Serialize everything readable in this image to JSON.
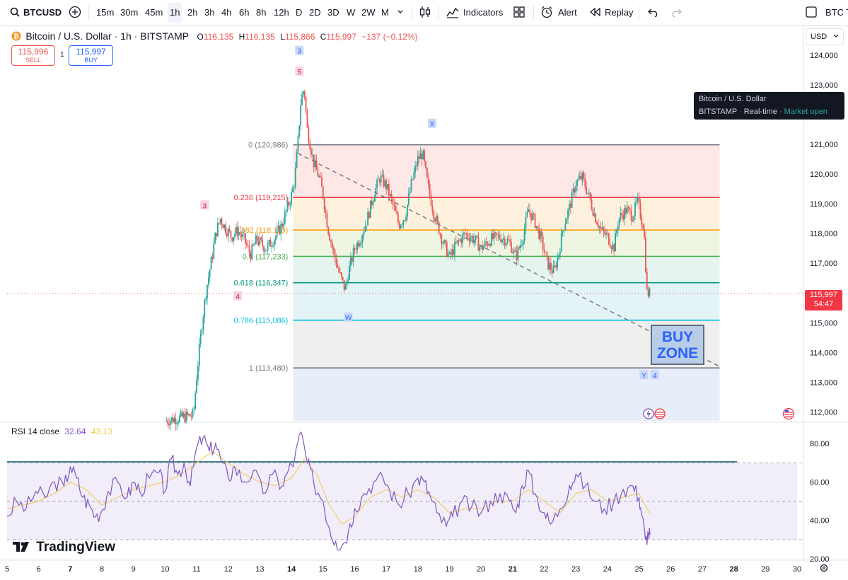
{
  "toolbar": {
    "symbol": "BTCUSD",
    "timeframes": [
      "15m",
      "30m",
      "45m",
      "1h",
      "2h",
      "3h",
      "4h",
      "6h",
      "8h",
      "12h",
      "D",
      "2D",
      "3D",
      "W",
      "2W",
      "M"
    ],
    "active_timeframe": "1h",
    "indicators_label": "Indicators",
    "alert_label": "Alert",
    "replay_label": "Replay",
    "right_label": "BTC T"
  },
  "legend": {
    "title": "Bitcoin / U.S. Dollar · 1h · BITSTAMP",
    "o_label": "O",
    "o_value": "116,135",
    "h_label": "H",
    "h_value": "116,135",
    "l_label": "L",
    "l_value": "115,866",
    "c_label": "C",
    "c_value": "115,997",
    "change": "−137 (−0.12%)",
    "sell_price": "115,996",
    "sell_label": "SELL",
    "spread": "1",
    "buy_price": "115,997",
    "buy_label": "BUY"
  },
  "currency": "USD",
  "tooltip": {
    "title": "Bitcoin / U.S. Dollar",
    "exchange": "BITSTAMP",
    "realtime": "Real-time",
    "status": "Market open"
  },
  "price_badge": {
    "price": "115,997",
    "countdown": "54:47"
  },
  "rsi": {
    "label": "RSI 14 close",
    "value": "32.64",
    "ma_value": "43.13"
  },
  "buy_zone": {
    "line1": "BUY",
    "line2": "ZONE"
  },
  "brand": "TradingView",
  "colors": {
    "up": "#26a69a",
    "down": "#ef5350",
    "rsi": "#7e57c2",
    "rsi_ma": "#f2c94c",
    "accent": "#2962ff"
  },
  "chart_data": {
    "type": "candlestick",
    "symbol": "BTCUSD",
    "interval": "1h",
    "ylim": [
      111700,
      125000
    ],
    "y_ticks": [
      112000,
      113000,
      114000,
      115000,
      116000,
      117000,
      118000,
      119000,
      120000,
      121000,
      122000,
      123000,
      124000
    ],
    "y_tick_labels": [
      "112,000",
      "113,000",
      "114,000",
      "115,000",
      "116,000",
      "117,000",
      "118,000",
      "119,000",
      "120,000",
      "121,000",
      "122,000",
      "123,000",
      "124,000"
    ],
    "x_ticks": [
      "5",
      "6",
      "7",
      "8",
      "9",
      "10",
      "11",
      "12",
      "13",
      "14",
      "15",
      "16",
      "17",
      "18",
      "19",
      "20",
      "21",
      "22",
      "23",
      "24",
      "25",
      "26",
      "27",
      "28",
      "29",
      "30"
    ],
    "x_tick_bold": [
      "7",
      "14",
      "21",
      "28"
    ],
    "x_range_days": [
      5,
      30
    ],
    "close_path": [
      [
        10.0,
        111700
      ],
      [
        10.9,
        111900
      ],
      [
        11.0,
        113200
      ],
      [
        11.15,
        114800
      ],
      [
        11.3,
        116100
      ],
      [
        11.5,
        117300
      ],
      [
        11.6,
        118000
      ],
      [
        11.75,
        118500
      ],
      [
        11.9,
        118200
      ],
      [
        12.1,
        117900
      ],
      [
        12.3,
        118100
      ],
      [
        12.5,
        117800
      ],
      [
        12.7,
        117300
      ],
      [
        12.9,
        117800
      ],
      [
        13.2,
        117500
      ],
      [
        13.5,
        117900
      ],
      [
        13.7,
        118300
      ],
      [
        13.85,
        118800
      ],
      [
        14.0,
        119300
      ],
      [
        14.1,
        119800
      ],
      [
        14.2,
        121000
      ],
      [
        14.3,
        122500
      ],
      [
        14.4,
        122900
      ],
      [
        14.5,
        121500
      ],
      [
        14.7,
        120400
      ],
      [
        14.9,
        119800
      ],
      [
        15.0,
        119300
      ],
      [
        15.15,
        118200
      ],
      [
        15.3,
        117500
      ],
      [
        15.5,
        116700
      ],
      [
        15.7,
        116100
      ],
      [
        15.8,
        116700
      ],
      [
        16.0,
        117500
      ],
      [
        16.2,
        117900
      ],
      [
        16.4,
        118500
      ],
      [
        16.6,
        119300
      ],
      [
        16.8,
        119900
      ],
      [
        17.0,
        119600
      ],
      [
        17.2,
        119000
      ],
      [
        17.4,
        118300
      ],
      [
        17.6,
        118600
      ],
      [
        17.8,
        119700
      ],
      [
        18.0,
        120500
      ],
      [
        18.15,
        120700
      ],
      [
        18.3,
        119700
      ],
      [
        18.5,
        118700
      ],
      [
        18.8,
        117700
      ],
      [
        19.0,
        117200
      ],
      [
        19.2,
        117600
      ],
      [
        19.5,
        118000
      ],
      [
        19.8,
        117800
      ],
      [
        20.0,
        117500
      ],
      [
        20.3,
        117800
      ],
      [
        20.6,
        117900
      ],
      [
        20.9,
        117700
      ],
      [
        21.1,
        117200
      ],
      [
        21.3,
        117800
      ],
      [
        21.5,
        118800
      ],
      [
        21.7,
        118400
      ],
      [
        21.9,
        117800
      ],
      [
        22.1,
        117000
      ],
      [
        22.3,
        116700
      ],
      [
        22.45,
        117300
      ],
      [
        22.6,
        118200
      ],
      [
        22.8,
        118900
      ],
      [
        23.0,
        119700
      ],
      [
        23.2,
        119900
      ],
      [
        23.4,
        119300
      ],
      [
        23.6,
        118600
      ],
      [
        23.8,
        118100
      ],
      [
        24.0,
        117900
      ],
      [
        24.2,
        117500
      ],
      [
        24.35,
        118500
      ],
      [
        24.6,
        118800
      ],
      [
        24.8,
        118600
      ],
      [
        24.95,
        119100
      ],
      [
        25.05,
        118600
      ],
      [
        25.15,
        118200
      ],
      [
        25.2,
        117100
      ],
      [
        25.25,
        116000
      ],
      [
        25.35,
        115997
      ]
    ],
    "last_price": 115997,
    "fibonacci": [
      {
        "level": "0",
        "price": 120986,
        "label": "0 (120,986)",
        "color": "#787b86"
      },
      {
        "level": "0.236",
        "price": 119215,
        "label": "0.236 (119,215)",
        "color": "#f23645"
      },
      {
        "level": "0.382",
        "price": 118119,
        "label": "0.382 (118,119)",
        "color": "#ff9800"
      },
      {
        "level": "0.5",
        "price": 117233,
        "label": "0.5 (117,233)",
        "color": "#4caf50"
      },
      {
        "level": "0.618",
        "price": 116347,
        "label": "0.618 (116,347)",
        "color": "#089981"
      },
      {
        "level": "0.786",
        "price": 115086,
        "label": "0.786 (115,086)",
        "color": "#00bcd4"
      },
      {
        "level": "1",
        "price": 113480,
        "label": "1 (113,480)",
        "color": "#787b86"
      }
    ],
    "fib_range_days": [
      14.05,
      27.55
    ],
    "trendline": [
      [
        14.2,
        120700
      ],
      [
        27.6,
        113500
      ]
    ],
    "wave_labels": [
      {
        "text": "3",
        "day": 14.25,
        "price": 124150,
        "style": "blue"
      },
      {
        "text": "5",
        "day": 14.25,
        "price": 123450,
        "style": "pink"
      },
      {
        "text": "X",
        "day": 18.45,
        "price": 121700,
        "style": "blue"
      },
      {
        "text": "3",
        "day": 11.25,
        "price": 118950,
        "style": "pink"
      },
      {
        "text": "4",
        "day": 12.3,
        "price": 115900,
        "style": "pink"
      },
      {
        "text": "W",
        "day": 15.8,
        "price": 115180,
        "style": "blue"
      },
      {
        "text": "Y",
        "day": 25.15,
        "price": 113240,
        "style": "blue"
      },
      {
        "text": "4",
        "day": 25.5,
        "price": 113240,
        "style": "blue"
      }
    ],
    "rsi_ylim": [
      20,
      90
    ],
    "rsi_ticks": [
      80,
      60,
      40,
      20
    ],
    "rsi_tick_labels": [
      "80.00",
      "60.00",
      "40.00",
      "20.00"
    ],
    "rsi_levels": {
      "overbought": 70,
      "middle": 50,
      "oversold": 30
    },
    "rsi_horizontal_line": 70.5,
    "rsi_path": [
      [
        5.0,
        42
      ],
      [
        5.3,
        50
      ],
      [
        5.6,
        46
      ],
      [
        5.9,
        55
      ],
      [
        6.2,
        52
      ],
      [
        6.5,
        60
      ],
      [
        6.8,
        58
      ],
      [
        7.0,
        68
      ],
      [
        7.2,
        62
      ],
      [
        7.4,
        52
      ],
      [
        7.6,
        48
      ],
      [
        7.8,
        42
      ],
      [
        8.0,
        45
      ],
      [
        8.2,
        55
      ],
      [
        8.5,
        60
      ],
      [
        8.8,
        52
      ],
      [
        9.0,
        60
      ],
      [
        9.2,
        55
      ],
      [
        9.5,
        62
      ],
      [
        9.8,
        65
      ],
      [
        10.0,
        55
      ],
      [
        10.2,
        72
      ],
      [
        10.4,
        64
      ],
      [
        10.6,
        70
      ],
      [
        10.8,
        58
      ],
      [
        11.0,
        78
      ],
      [
        11.2,
        83
      ],
      [
        11.4,
        76
      ],
      [
        11.6,
        80
      ],
      [
        11.8,
        70
      ],
      [
        12.0,
        62
      ],
      [
        12.2,
        68
      ],
      [
        12.5,
        60
      ],
      [
        12.8,
        66
      ],
      [
        13.1,
        54
      ],
      [
        13.4,
        64
      ],
      [
        13.7,
        58
      ],
      [
        13.9,
        66
      ],
      [
        14.1,
        72
      ],
      [
        14.3,
        86
      ],
      [
        14.5,
        70
      ],
      [
        14.7,
        60
      ],
      [
        15.0,
        50
      ],
      [
        15.2,
        36
      ],
      [
        15.4,
        29
      ],
      [
        15.6,
        27
      ],
      [
        15.8,
        34
      ],
      [
        16.0,
        46
      ],
      [
        16.3,
        54
      ],
      [
        16.6,
        60
      ],
      [
        16.9,
        62
      ],
      [
        17.1,
        56
      ],
      [
        17.4,
        48
      ],
      [
        17.7,
        54
      ],
      [
        18.0,
        62
      ],
      [
        18.2,
        60
      ],
      [
        18.4,
        52
      ],
      [
        18.6,
        44
      ],
      [
        18.9,
        37
      ],
      [
        19.1,
        42
      ],
      [
        19.4,
        50
      ],
      [
        19.7,
        47
      ],
      [
        20.0,
        44
      ],
      [
        20.3,
        50
      ],
      [
        20.6,
        54
      ],
      [
        20.9,
        50
      ],
      [
        21.1,
        44
      ],
      [
        21.3,
        58
      ],
      [
        21.5,
        66
      ],
      [
        21.7,
        54
      ],
      [
        22.0,
        44
      ],
      [
        22.2,
        38
      ],
      [
        22.5,
        46
      ],
      [
        22.8,
        58
      ],
      [
        23.0,
        64
      ],
      [
        23.3,
        58
      ],
      [
        23.6,
        50
      ],
      [
        23.9,
        46
      ],
      [
        24.2,
        50
      ],
      [
        24.5,
        56
      ],
      [
        24.8,
        58
      ],
      [
        25.0,
        52
      ],
      [
        25.1,
        42
      ],
      [
        25.2,
        30
      ],
      [
        25.3,
        33
      ],
      [
        25.35,
        32.64
      ]
    ],
    "rsi_ma_path": [
      [
        5.0,
        46
      ],
      [
        5.5,
        48
      ],
      [
        6.0,
        50
      ],
      [
        6.5,
        54
      ],
      [
        7.0,
        60
      ],
      [
        7.5,
        56
      ],
      [
        8.0,
        48
      ],
      [
        8.5,
        52
      ],
      [
        9.0,
        56
      ],
      [
        9.5,
        58
      ],
      [
        10.0,
        60
      ],
      [
        10.5,
        64
      ],
      [
        11.0,
        70
      ],
      [
        11.5,
        76
      ],
      [
        12.0,
        70
      ],
      [
        12.5,
        64
      ],
      [
        13.0,
        60
      ],
      [
        13.5,
        58
      ],
      [
        14.0,
        62
      ],
      [
        14.4,
        72
      ],
      [
        14.8,
        64
      ],
      [
        15.2,
        48
      ],
      [
        15.6,
        38
      ],
      [
        16.0,
        42
      ],
      [
        16.5,
        52
      ],
      [
        17.0,
        56
      ],
      [
        17.5,
        52
      ],
      [
        18.0,
        56
      ],
      [
        18.5,
        52
      ],
      [
        19.0,
        44
      ],
      [
        19.5,
        46
      ],
      [
        20.0,
        46
      ],
      [
        20.5,
        50
      ],
      [
        21.0,
        50
      ],
      [
        21.5,
        56
      ],
      [
        22.0,
        50
      ],
      [
        22.5,
        44
      ],
      [
        23.0,
        54
      ],
      [
        23.5,
        56
      ],
      [
        24.0,
        50
      ],
      [
        24.5,
        52
      ],
      [
        25.0,
        54
      ],
      [
        25.35,
        43.13
      ]
    ]
  }
}
